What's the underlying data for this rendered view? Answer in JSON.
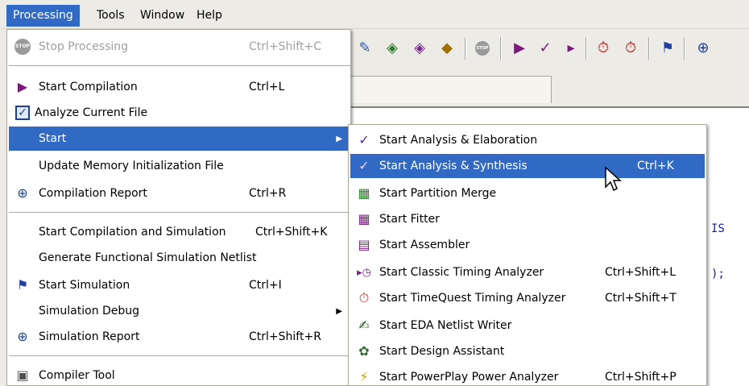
{
  "menubar": {
    "items": [
      {
        "label": "Processing",
        "active": true
      },
      {
        "label": "Tools",
        "active": false
      },
      {
        "label": "Window",
        "active": false
      },
      {
        "label": "Help",
        "active": false
      }
    ]
  },
  "editor": {
    "lines": [
      "IS",
      ");"
    ]
  },
  "processing_menu": {
    "items": [
      {
        "label": "Stop Processing",
        "shortcut": "Ctrl+Shift+C",
        "icon": "stop-icon",
        "disabled": true
      },
      {
        "label": "Start Compilation",
        "shortcut": "Ctrl+L",
        "icon": "play-icon"
      },
      {
        "label": "Analyze Current File",
        "shortcut": "",
        "icon": "analyze-file-icon"
      },
      {
        "label": "Start",
        "shortcut": "",
        "highlighted": true,
        "has_submenu": true
      },
      {
        "label": "Update Memory Initialization File",
        "shortcut": ""
      },
      {
        "label": "Compilation Report",
        "shortcut": "Ctrl+R",
        "icon": "report-icon"
      },
      {
        "label": "Start Compilation and Simulation",
        "shortcut": "Ctrl+Shift+K"
      },
      {
        "label": "Generate Functional Simulation Netlist",
        "shortcut": ""
      },
      {
        "label": "Start Simulation",
        "shortcut": "Ctrl+I",
        "icon": "simulation-icon"
      },
      {
        "label": "Simulation Debug",
        "shortcut": "",
        "has_submenu": true
      },
      {
        "label": "Simulation Report",
        "shortcut": "Ctrl+Shift+R",
        "icon": "simulation-report-icon"
      },
      {
        "label": "Compiler Tool",
        "shortcut": "",
        "icon": "compiler-tool-icon"
      }
    ]
  },
  "start_submenu": {
    "items": [
      {
        "label": "Start Analysis & Elaboration",
        "shortcut": "",
        "icon": "analysis-elaboration-icon"
      },
      {
        "label": "Start Analysis & Synthesis",
        "shortcut": "Ctrl+K",
        "icon": "analysis-synthesis-icon",
        "highlighted": true
      },
      {
        "label": "Start Partition Merge",
        "shortcut": "",
        "icon": "partition-merge-icon"
      },
      {
        "label": "Start Fitter",
        "shortcut": "",
        "icon": "fitter-icon"
      },
      {
        "label": "Start Assembler",
        "shortcut": "",
        "icon": "assembler-icon"
      },
      {
        "label": "Start Classic Timing Analyzer",
        "shortcut": "Ctrl+Shift+L",
        "icon": "classic-timing-icon"
      },
      {
        "label": "Start TimeQuest Timing Analyzer",
        "shortcut": "Ctrl+Shift+T",
        "icon": "timequest-icon"
      },
      {
        "label": "Start EDA Netlist Writer",
        "shortcut": "",
        "icon": "eda-netlist-icon"
      },
      {
        "label": "Start Design Assistant",
        "shortcut": "",
        "icon": "design-assistant-icon"
      },
      {
        "label": "Start PowerPlay Power Analyzer",
        "shortcut": "Ctrl+Shift+P",
        "icon": "powerplay-icon"
      }
    ]
  },
  "colors": {
    "highlight": "#316ac5",
    "menu_bg": "#ffffff",
    "menubar_bg": "#ecebe6",
    "disabled_text": "#a0a0a0"
  }
}
